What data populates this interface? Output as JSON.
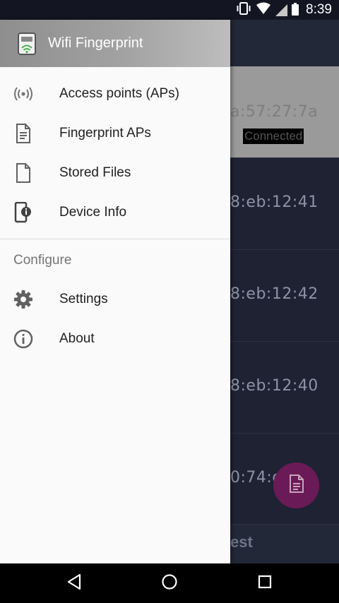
{
  "status_bar": {
    "time": "8:39",
    "icons": [
      "vibrate-icon",
      "wifi-icon",
      "cell-signal-icon",
      "battery-icon"
    ]
  },
  "drawer": {
    "header_title": "Wifi Fingerprint",
    "header_icon": "wifi-fingerprint-logo-icon",
    "items": [
      {
        "label": "Access points (APs)",
        "icon": "access-point-icon"
      },
      {
        "label": "Fingerprint APs",
        "icon": "document-icon"
      },
      {
        "label": "Stored Files",
        "icon": "file-icon"
      },
      {
        "label": "Device Info",
        "icon": "device-info-icon"
      }
    ],
    "section_title": "Configure",
    "config_items": [
      {
        "label": "Settings",
        "icon": "gear-icon"
      },
      {
        "label": "About",
        "icon": "info-icon"
      }
    ]
  },
  "background_list": {
    "rows": [
      {
        "mac_partial": "a:57:27:7a",
        "status": "Connected"
      },
      {
        "mac_partial": "8:eb:12:41"
      },
      {
        "mac_partial": "8:eb:12:42"
      },
      {
        "mac_partial": "8:eb:12:40"
      },
      {
        "mac_partial": "0:74:d"
      }
    ],
    "bottom_text": "est",
    "fab_icon": "document-icon"
  },
  "nav_bar": {
    "buttons": [
      "back-icon",
      "home-icon",
      "recents-icon"
    ]
  },
  "colors": {
    "drawer_bg": "#fafafa",
    "header_gradient": "#a3a3a3",
    "app_bg": "#1e2232",
    "fab": "#6a1a56",
    "wifi_green": "#4caf50"
  }
}
